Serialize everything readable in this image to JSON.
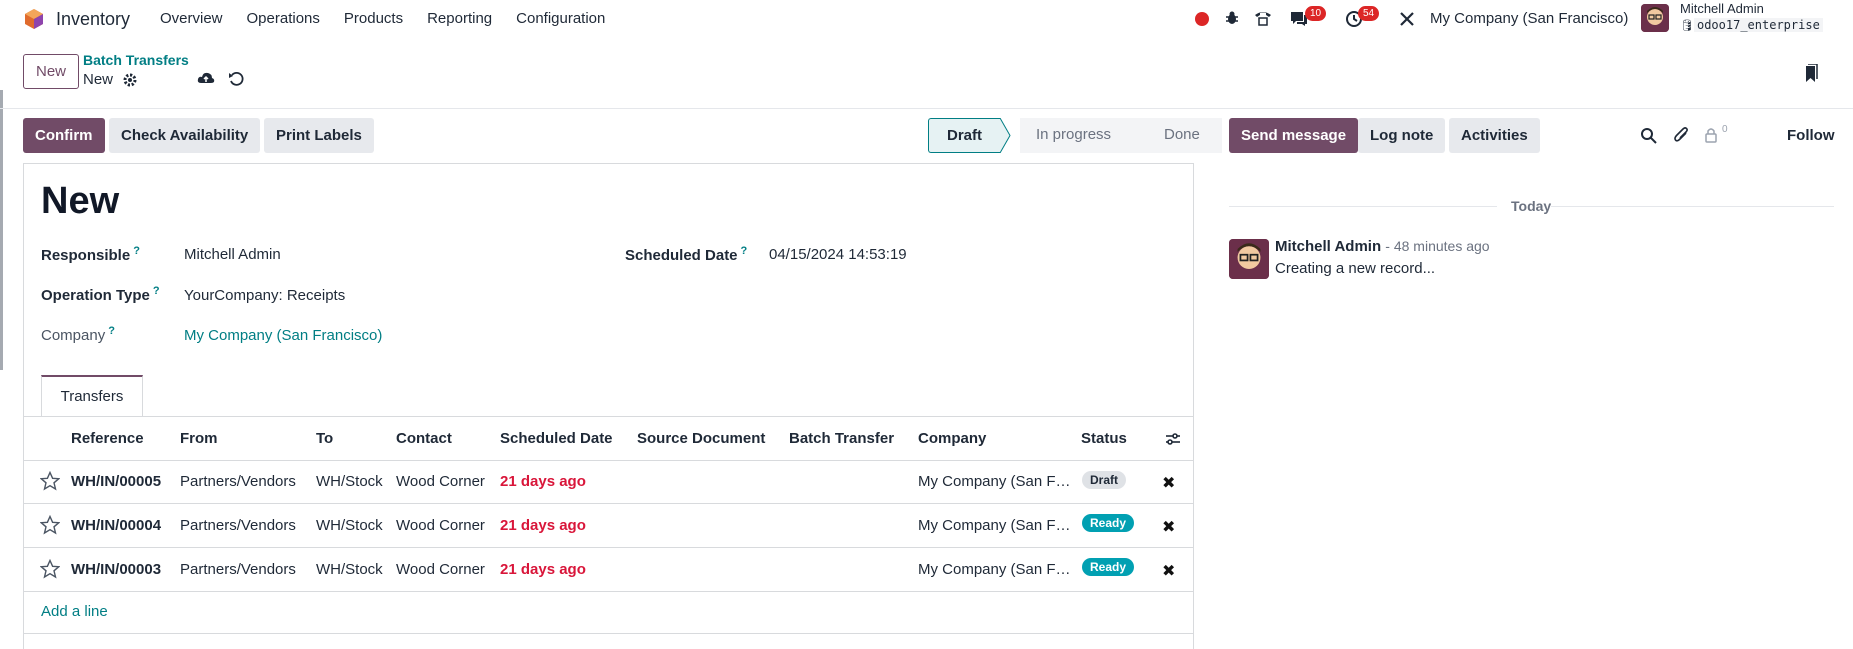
{
  "app": {
    "name": "Inventory"
  },
  "menu": [
    "Overview",
    "Operations",
    "Products",
    "Reporting",
    "Configuration"
  ],
  "systray": {
    "messages_count": "10",
    "activities_count": "54",
    "company": "My Company (San Francisco)",
    "user_name": "Mitchell Admin",
    "database": "odoo17_enterprise"
  },
  "control": {
    "new_button": "New",
    "breadcrumb_parent": "Batch Transfers",
    "breadcrumb_current": "New"
  },
  "actions": {
    "confirm": "Confirm",
    "check_availability": "Check Availability",
    "print_labels": "Print Labels"
  },
  "status_stages": [
    "Draft",
    "In progress",
    "Done"
  ],
  "chatter": {
    "send_message": "Send message",
    "log_note": "Log note",
    "activities": "Activities",
    "followers_count": "0",
    "follow": "Follow",
    "date_separator": "Today",
    "message": {
      "author": "Mitchell Admin",
      "time": "- 48 minutes ago",
      "body": "Creating a new record..."
    }
  },
  "form": {
    "title": "New",
    "responsible_label": "Responsible",
    "responsible_value": "Mitchell Admin",
    "scheduled_date_label": "Scheduled Date",
    "scheduled_date_value": "04/15/2024 14:53:19",
    "operation_type_label": "Operation Type",
    "operation_type_value": "YourCompany: Receipts",
    "company_label": "Company",
    "company_value": "My Company (San Francisco)",
    "help_mark": "?"
  },
  "tabs": [
    "Transfers"
  ],
  "table": {
    "columns": [
      "Reference",
      "From",
      "To",
      "Contact",
      "Scheduled Date",
      "Source Document",
      "Batch Transfer",
      "Company",
      "Status"
    ],
    "rows": [
      {
        "reference": "WH/IN/00005",
        "from": "Partners/Vendors",
        "to": "WH/Stock",
        "contact": "Wood Corner",
        "scheduled": "21 days ago",
        "company": "My Company (San F…",
        "status": "Draft"
      },
      {
        "reference": "WH/IN/00004",
        "from": "Partners/Vendors",
        "to": "WH/Stock",
        "contact": "Wood Corner",
        "scheduled": "21 days ago",
        "company": "My Company (San F…",
        "status": "Ready"
      },
      {
        "reference": "WH/IN/00003",
        "from": "Partners/Vendors",
        "to": "WH/Stock",
        "contact": "Wood Corner",
        "scheduled": "21 days ago",
        "company": "My Company (San F…",
        "status": "Ready"
      }
    ],
    "add_line": "Add a line"
  },
  "colors": {
    "primary": "#714b67",
    "link": "#017e84",
    "danger": "#d9163a",
    "ready": "#01a0b2"
  }
}
